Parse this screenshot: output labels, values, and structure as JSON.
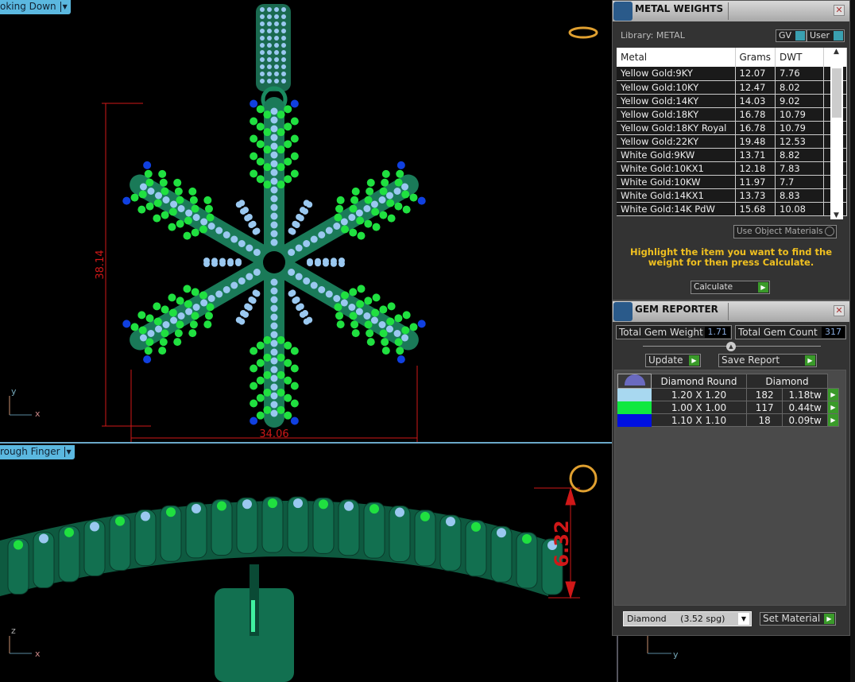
{
  "viewports": {
    "top": {
      "label": "oking Down",
      "dim_height": "38.14",
      "dim_width": "34.06",
      "axis_x": "x",
      "axis_y": "y"
    },
    "bottom": {
      "label": "rough Finger",
      "dim_height": "6.32",
      "axis_x": "x",
      "axis_z": "z"
    },
    "side": {
      "axis_y": "y"
    }
  },
  "metal_weights": {
    "title": "METAL WEIGHTS",
    "library": "Library: METAL",
    "gv_label": "GV",
    "user_label": "User",
    "columns": [
      "Metal",
      "Grams",
      "DWT"
    ],
    "rows": [
      [
        "Yellow Gold:9KY",
        "12.07",
        "7.76"
      ],
      [
        "Yellow Gold:10KY",
        "12.47",
        "8.02"
      ],
      [
        "Yellow Gold:14KY",
        "14.03",
        "9.02"
      ],
      [
        "Yellow Gold:18KY",
        "16.78",
        "10.79"
      ],
      [
        "Yellow Gold:18KY Royal",
        "16.78",
        "10.79"
      ],
      [
        "Yellow Gold:22KY",
        "19.48",
        "12.53"
      ],
      [
        "White Gold:9KW",
        "13.71",
        "8.82"
      ],
      [
        "White Gold:10KX1",
        "12.18",
        "7.83"
      ],
      [
        "White Gold:10KW",
        "11.97",
        "7.7"
      ],
      [
        "White Gold:14KX1",
        "13.73",
        "8.83"
      ],
      [
        "White Gold:14K PdW",
        "15.68",
        "10.08"
      ]
    ],
    "use_object_materials": "Use Object Materials",
    "instructions": "Highlight the item you want to find the weight for then press Calculate.",
    "calculate": "Calculate"
  },
  "gem_reporter": {
    "title": "GEM REPORTER",
    "total_weight_label": "Total Gem Weight",
    "total_weight": "1.71",
    "total_count_label": "Total Gem Count",
    "total_count": "317",
    "update": "Update",
    "save_report": "Save Report",
    "header_shape": "Diamond Round",
    "header_material": "Diamond",
    "rows": [
      {
        "color": "#a8d8f0",
        "size": "1.20 X 1.20",
        "count": "182",
        "weight": "1.18tw"
      },
      {
        "color": "#10e840",
        "size": "1.00 X 1.00",
        "count": "117",
        "weight": "0.44tw"
      },
      {
        "color": "#0010e0",
        "size": "1.10 X 1.10",
        "count": "18",
        "weight": "0.09tw"
      }
    ],
    "material_select": "Diamond     (3.52 spg)",
    "set_material": "Set Material"
  }
}
